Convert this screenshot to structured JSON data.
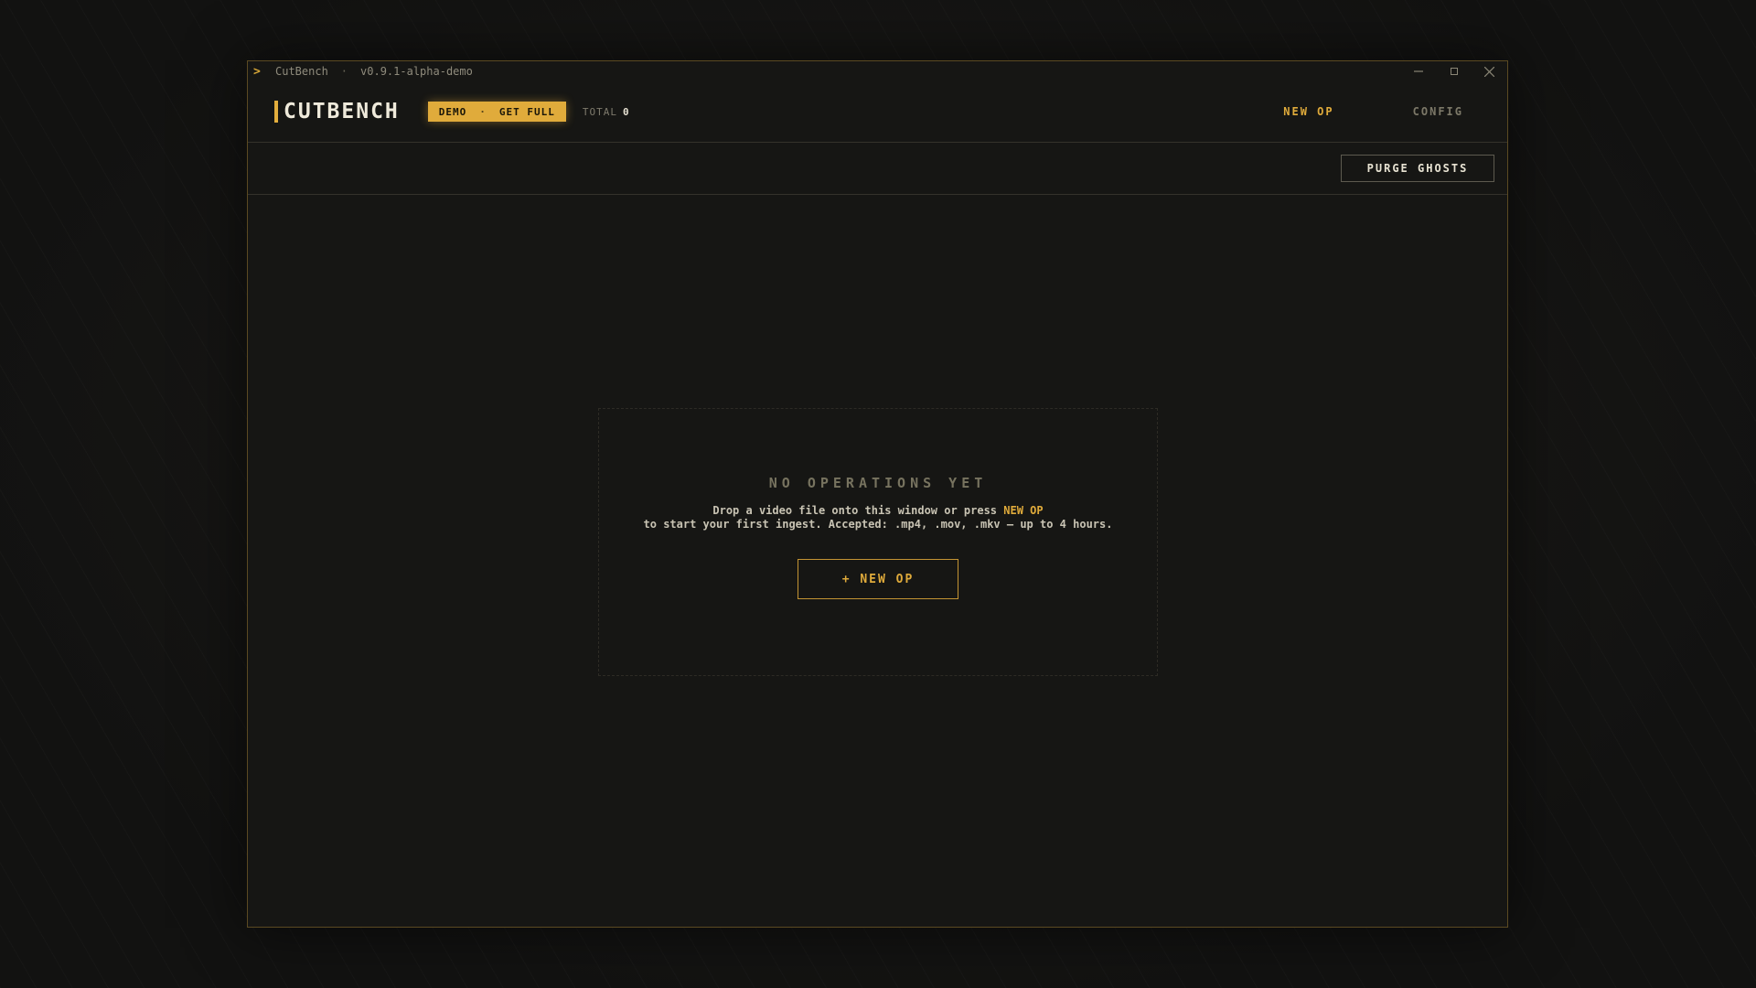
{
  "titlebar": {
    "app_name": "CutBench",
    "separator": "·",
    "version": "v0.9.1-alpha-demo",
    "prompt_icon": "chevron-right-icon"
  },
  "window_controls": {
    "minimize_icon": "minimize-icon",
    "maximize_icon": "maximize-icon",
    "close_icon": "close-icon"
  },
  "header": {
    "logo_text": "CUTBENCH",
    "badge_demo": "DEMO",
    "badge_dot": "·",
    "badge_cta": "GET FULL",
    "total_label": "TOTAL",
    "total_value": "0",
    "nav": {
      "new_op": "NEW OP",
      "config": "CONFIG"
    }
  },
  "toolbar": {
    "purge_label": "PURGE GHOSTS"
  },
  "empty_state": {
    "title": "NO OPERATIONS YET",
    "desc_line1_prefix": "Drop a video file onto this window or press ",
    "desc_highlight": "NEW OP",
    "desc_line2": "to start your first ingest. Accepted: .mp4, .mov, .mkv — up to 4 hours.",
    "button_label": "+ NEW OP"
  },
  "colors": {
    "accent": "#e0ab3b",
    "background": "#161614",
    "window_border": "#5b4a22",
    "text_primary": "#efeadb",
    "text_muted": "#7c7868"
  }
}
